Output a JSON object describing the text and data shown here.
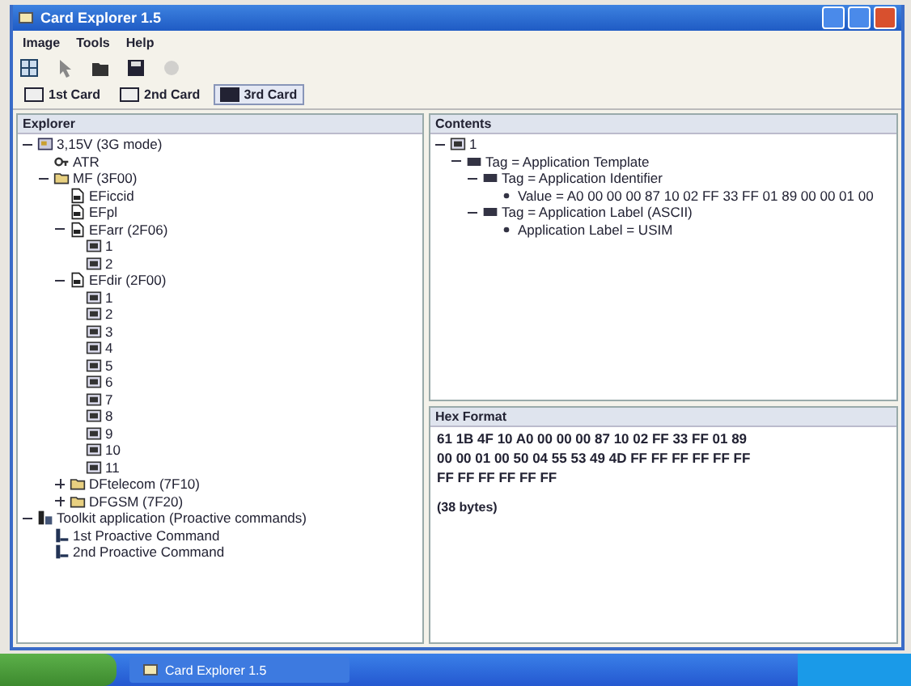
{
  "window": {
    "title": "Card Explorer 1.5"
  },
  "menu": [
    "Image",
    "Tools",
    "Help"
  ],
  "cards": [
    {
      "label": "1st Card",
      "selected": false
    },
    {
      "label": "2nd Card",
      "selected": false
    },
    {
      "label": "3rd Card",
      "selected": true
    }
  ],
  "explorer": {
    "title": "Explorer",
    "tree": [
      {
        "kind": "card",
        "label": "3,15V (3G mode)",
        "expanded": true,
        "children": [
          {
            "kind": "atr",
            "label": "ATR"
          },
          {
            "kind": "folder",
            "label": "MF (3F00)",
            "expanded": true,
            "children": [
              {
                "kind": "file",
                "label": "EFiccid"
              },
              {
                "kind": "file",
                "label": "EFpl"
              },
              {
                "kind": "file",
                "label": "EFarr (2F06)",
                "expanded": true,
                "children": [
                  {
                    "kind": "record",
                    "label": "1"
                  },
                  {
                    "kind": "record",
                    "label": "2"
                  }
                ]
              },
              {
                "kind": "file",
                "label": "EFdir (2F00)",
                "expanded": true,
                "children": [
                  {
                    "kind": "record",
                    "label": "1"
                  },
                  {
                    "kind": "record",
                    "label": "2"
                  },
                  {
                    "kind": "record",
                    "label": "3"
                  },
                  {
                    "kind": "record",
                    "label": "4"
                  },
                  {
                    "kind": "record",
                    "label": "5"
                  },
                  {
                    "kind": "record",
                    "label": "6"
                  },
                  {
                    "kind": "record",
                    "label": "7"
                  },
                  {
                    "kind": "record",
                    "label": "8"
                  },
                  {
                    "kind": "record",
                    "label": "9"
                  },
                  {
                    "kind": "record",
                    "label": "10"
                  },
                  {
                    "kind": "record",
                    "label": "11"
                  }
                ]
              },
              {
                "kind": "folder",
                "label": "DFtelecom (7F10)",
                "expanded": false
              },
              {
                "kind": "folder",
                "label": "DFGSM (7F20)",
                "expanded": false
              }
            ]
          }
        ]
      },
      {
        "kind": "app",
        "label": "Toolkit application (Proactive commands)",
        "expanded": true,
        "children": [
          {
            "kind": "command",
            "label": "1st Proactive Command"
          },
          {
            "kind": "command",
            "label": "2nd Proactive Command"
          }
        ]
      }
    ]
  },
  "contents": {
    "title": "Contents",
    "tree": [
      {
        "kind": "record",
        "label": "1",
        "expanded": true,
        "children": [
          {
            "kind": "tag",
            "label": "Tag = Application Template",
            "expanded": true,
            "children": [
              {
                "kind": "tag",
                "label": "Tag = Application Identifier",
                "expanded": true,
                "children": [
                  {
                    "kind": "value",
                    "label": "Value = A0 00 00 00 87 10 02 FF 33 FF 01 89 00 00 01 00"
                  }
                ]
              },
              {
                "kind": "tag",
                "label": "Tag = Application Label (ASCII)",
                "expanded": true,
                "children": [
                  {
                    "kind": "value",
                    "label": "Application Label = USIM"
                  }
                ]
              }
            ]
          }
        ]
      }
    ]
  },
  "hex": {
    "title": "Hex Format",
    "lines": [
      "61 1B 4F 10 A0 00 00 00 87 10 02 FF 33 FF 01 89",
      "00 00 01 00 50 04 55 53 49 4D FF FF FF FF FF FF",
      "FF FF FF FF FF FF"
    ],
    "count": "(38 bytes)"
  },
  "taskbar": {
    "task": "Card Explorer 1.5"
  }
}
